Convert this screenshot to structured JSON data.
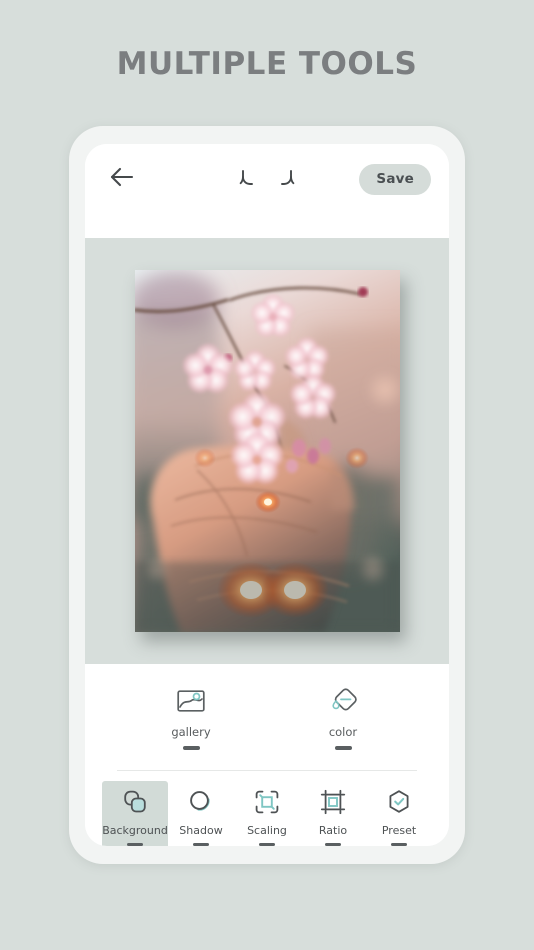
{
  "page": {
    "headline": "MULTIPLE TOOLS",
    "background_color": "#d7dedb",
    "headline_color": "#7b7e80"
  },
  "appbar": {
    "back_icon": "arrow-left-icon",
    "undo_icon": "undo-icon",
    "redo_icon": "redo-icon",
    "save_label": "Save",
    "save_bg_color": "#d5dcd9"
  },
  "canvas": {
    "background_color": "#d7dedb",
    "photo_alt": "hand holding cherry blossom branch with glowing lights"
  },
  "subtools": {
    "items": [
      {
        "label": "gallery",
        "icon": "image-picture-icon"
      },
      {
        "label": "color",
        "icon": "color-drop-icon"
      }
    ]
  },
  "bottomnav": {
    "accent_color": "#7fc6c3",
    "selected_bg_color": "#d2dbd7",
    "items": [
      {
        "label": "Background",
        "icon": "overlapping-shapes-icon",
        "selected": true
      },
      {
        "label": "Shadow",
        "icon": "circle-shadow-icon",
        "selected": false
      },
      {
        "label": "Scaling",
        "icon": "scaling-frame-icon",
        "selected": false
      },
      {
        "label": "Ratio",
        "icon": "crop-ratio-icon",
        "selected": false
      },
      {
        "label": "Preset",
        "icon": "hexagon-check-icon",
        "selected": false
      }
    ]
  }
}
